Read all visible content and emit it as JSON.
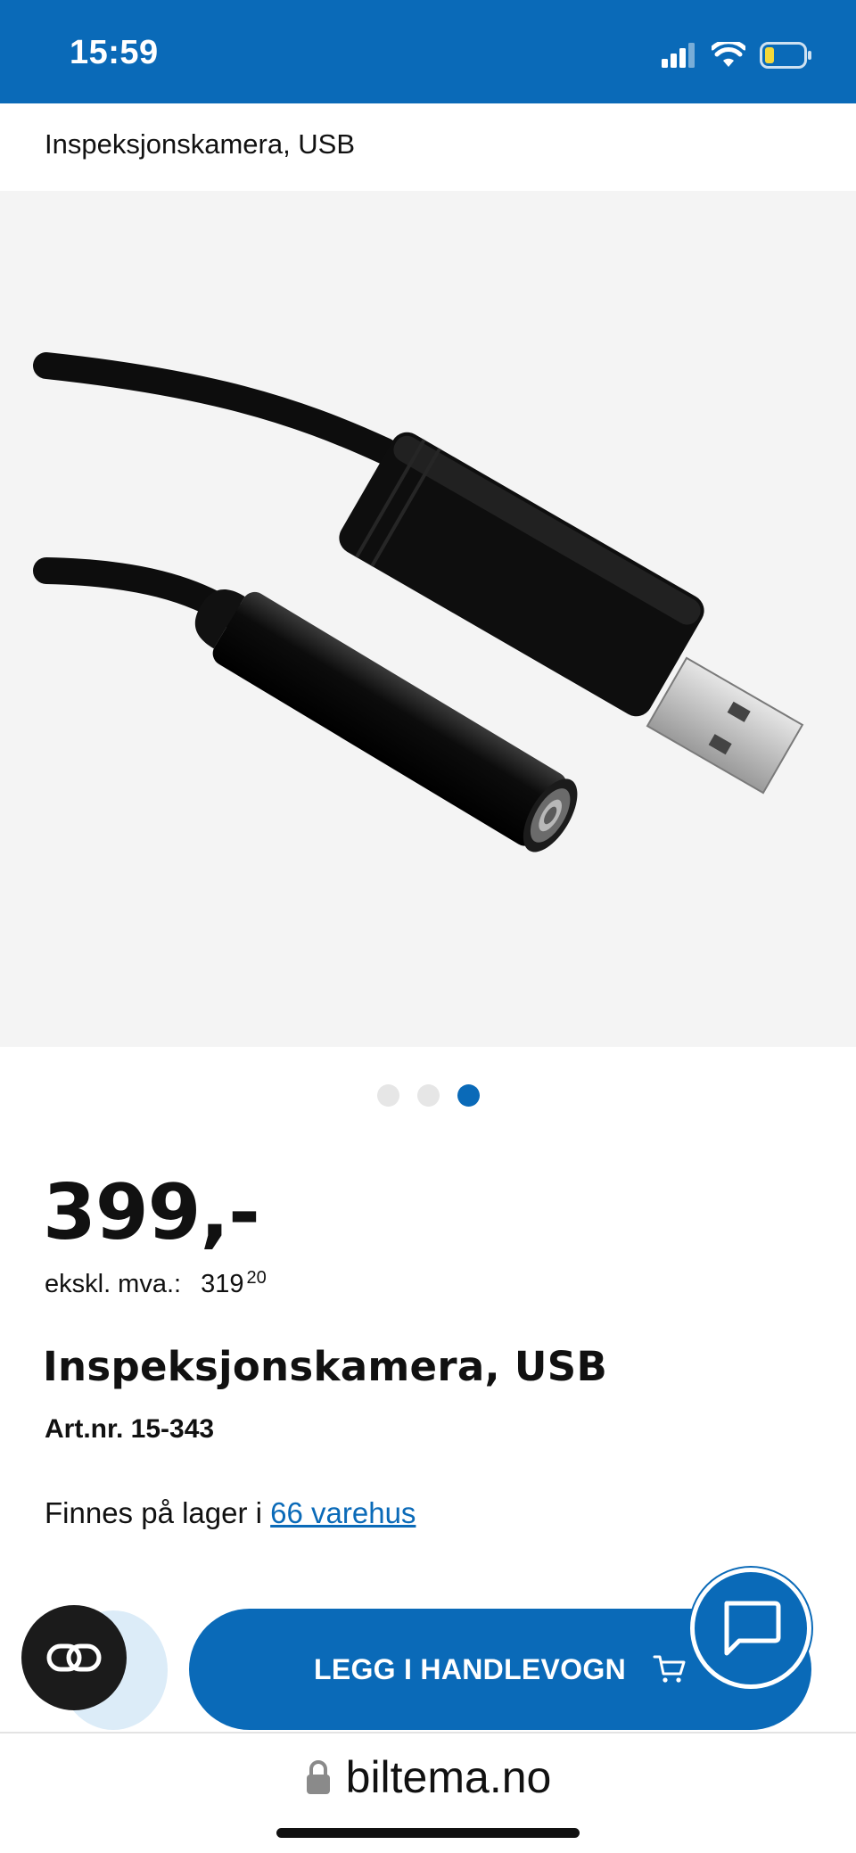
{
  "status_bar": {
    "time": "15:59",
    "icons": [
      "signal-icon",
      "wifi-icon",
      "battery-icon"
    ],
    "background": "#0a6ab8"
  },
  "breadcrumb": "Inspeksjonskamera, USB",
  "gallery": {
    "image": "usb-inspection-camera-photo",
    "dot_count": 3,
    "active_dot": 3
  },
  "product": {
    "price": "399,-",
    "ex_vat_label": "ekskl. mva.:",
    "ex_vat_main": "319",
    "ex_vat_cents": "20",
    "title": "Inspeksjonskamera, USB",
    "art_nr": "Art.nr. 15-343",
    "stock_prefix": "Finnes på lager i ",
    "stock_link": "66 varehus"
  },
  "actions": {
    "compare_icon": "link-icon",
    "add_to_cart_label": "LEGG I HANDLEVOGN",
    "cart_icon": "cart-icon",
    "chat_icon": "chat-bubble-icon"
  },
  "url_bar": {
    "domain": "biltema.no",
    "lock_icon": "lock-icon"
  },
  "colors": {
    "brand_blue": "#0a6ab8",
    "text": "#111111"
  }
}
